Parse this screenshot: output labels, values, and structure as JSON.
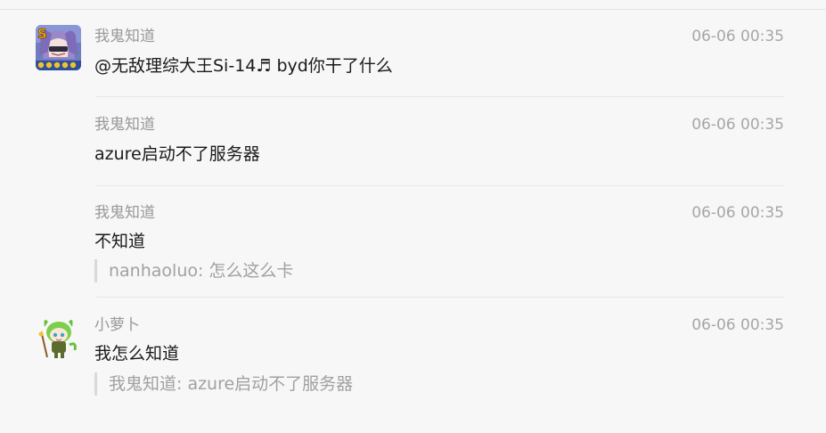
{
  "messages": [
    {
      "sender": "我鬼知道",
      "time": "06-06 00:35",
      "content": "@无敌理综大王Si-14♬ byd你干了什么",
      "avatar": "anime-avatar-1"
    },
    {
      "sender": "我鬼知道",
      "time": "06-06 00:35",
      "content": "azure启动不了服务器"
    },
    {
      "sender": "我鬼知道",
      "time": "06-06 00:35",
      "content": "不知道",
      "quote": "nanhaoluo: 怎么这么卡"
    },
    {
      "sender": "小萝卜",
      "time": "06-06 00:35",
      "content": "我怎么知道",
      "quote": "我鬼知道: azure启动不了服务器",
      "avatar": "green-chibi-avatar"
    }
  ],
  "colors": {
    "background": "#f7f7f8",
    "sender_text": "#999999",
    "content_text": "#1a1a1a",
    "quote_text": "#a1a1a1",
    "quote_bar": "#d9d9d9",
    "divider": "#e6e6e6"
  }
}
